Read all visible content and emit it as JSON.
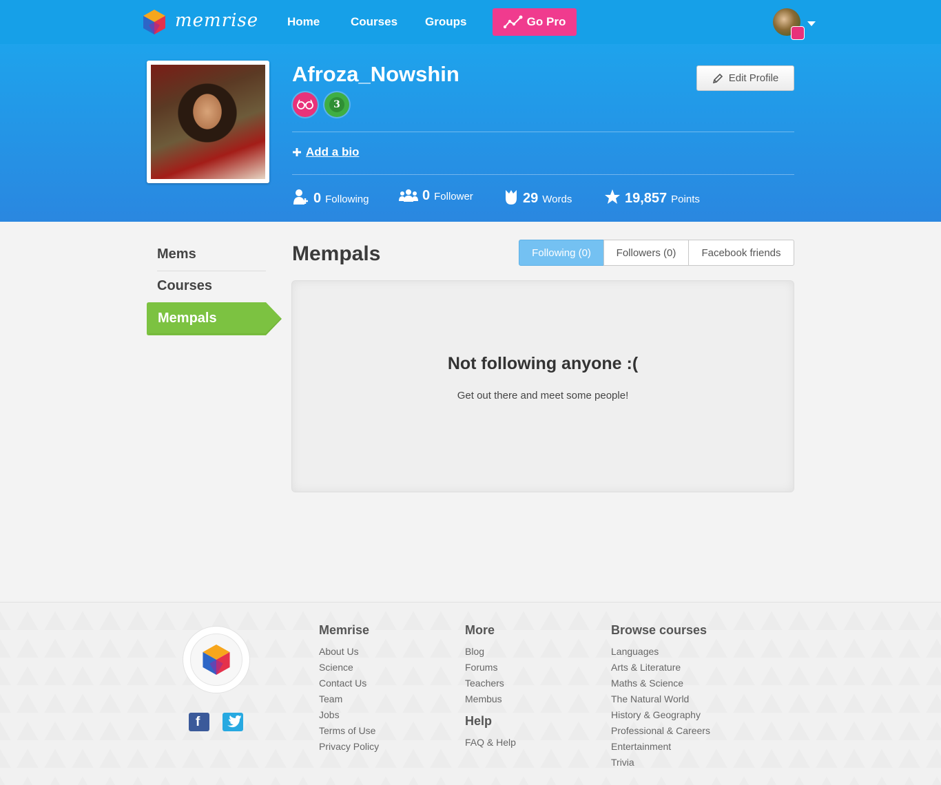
{
  "nav": {
    "brand": "memrise",
    "links": [
      "Home",
      "Courses",
      "Groups"
    ],
    "go_pro": "Go Pro",
    "colors": {
      "bar": "#16a0e8",
      "go_pro": "#f03b8e"
    }
  },
  "profile": {
    "username": "Afroza_Nowshin",
    "level_badge": "3",
    "edit_profile": "Edit Profile",
    "add_bio": "Add a bio",
    "stats": [
      {
        "value": "0",
        "label": "Following",
        "icon": "add-user-icon"
      },
      {
        "value": "0",
        "label": "Follower",
        "icon": "group-icon"
      },
      {
        "value": "29",
        "label": "Words",
        "icon": "flower-icon"
      },
      {
        "value": "19,857",
        "label": "Points",
        "icon": "star-icon"
      }
    ]
  },
  "sidebar": {
    "items": [
      {
        "label": "Mems"
      },
      {
        "label": "Courses"
      },
      {
        "label": "Mempals",
        "active": true
      }
    ],
    "active_color": "#7cc241"
  },
  "main": {
    "title": "Mempals",
    "tabs": [
      {
        "label": "Following (0)",
        "active": true
      },
      {
        "label": "Followers (0)"
      },
      {
        "label": "Facebook friends"
      }
    ],
    "empty_title": "Not following anyone :(",
    "empty_sub": "Get out there and meet some people!"
  },
  "footer": {
    "columns": [
      {
        "heading": "Memrise",
        "links": [
          "About Us",
          "Science",
          "Contact Us",
          "Team",
          "Jobs",
          "Terms of Use",
          "Privacy Policy"
        ]
      },
      {
        "heading": "More",
        "links": [
          "Blog",
          "Forums",
          "Teachers",
          "Membus"
        ]
      },
      {
        "heading": "Help",
        "links": [
          "FAQ & Help"
        ]
      },
      {
        "heading": "Browse courses",
        "links": [
          "Languages",
          "Arts & Literature",
          "Maths & Science",
          "The Natural World",
          "History & Geography",
          "Professional & Careers",
          "Entertainment",
          "Trivia"
        ]
      }
    ],
    "social": [
      "facebook-icon",
      "twitter-icon"
    ]
  }
}
